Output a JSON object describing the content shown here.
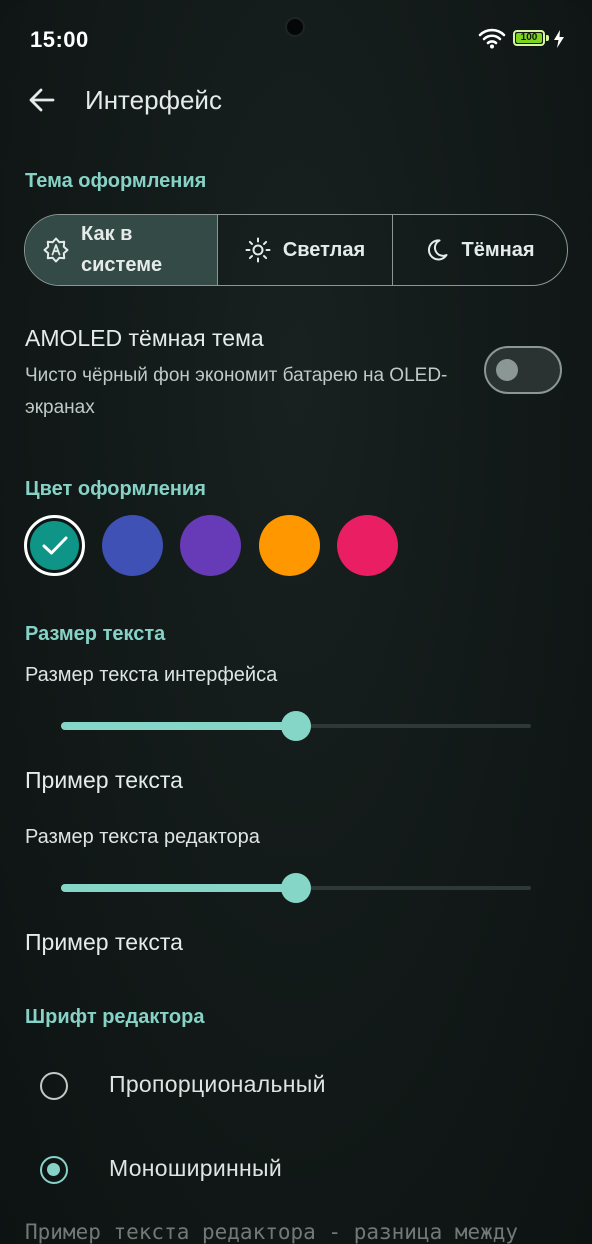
{
  "status_bar": {
    "time": "15:00",
    "battery": "100",
    "icons": [
      "wifi-icon",
      "battery-icon",
      "charging-bolt-icon"
    ]
  },
  "app_bar": {
    "title": "Интерфейс",
    "back_icon": "arrow-back-icon"
  },
  "theme": {
    "section_title": "Тема оформления",
    "options": [
      {
        "label": "Как в системе",
        "icon": "auto-brightness-icon",
        "selected": true
      },
      {
        "label": "Светлая",
        "icon": "sun-icon",
        "selected": false
      },
      {
        "label": "Тёмная",
        "icon": "moon-icon",
        "selected": false
      }
    ]
  },
  "amoled": {
    "title": "AMOLED тёмная тема",
    "description": "Чисто чёрный фон экономит батарею на OLED-экранах",
    "enabled": false
  },
  "accent": {
    "section_title": "Цвет оформления",
    "colors": [
      "#0f9488",
      "#3f51b5",
      "#673ab7",
      "#ff9800",
      "#e91e63"
    ],
    "selected_index": 0
  },
  "text_size": {
    "section_title": "Размер текста",
    "interface_label": "Размер текста интерфейса",
    "interface_value": 0.5,
    "interface_sample": "Пример текста",
    "editor_label": "Размер текста редактора",
    "editor_value": 0.5,
    "editor_sample": "Пример текста"
  },
  "editor_font": {
    "section_title": "Шрифт редактора",
    "options": [
      {
        "label": "Пропорциональный",
        "checked": false
      },
      {
        "label": "Моноширинный",
        "checked": true
      }
    ],
    "sample": "Пример текста редактора - разница между"
  }
}
